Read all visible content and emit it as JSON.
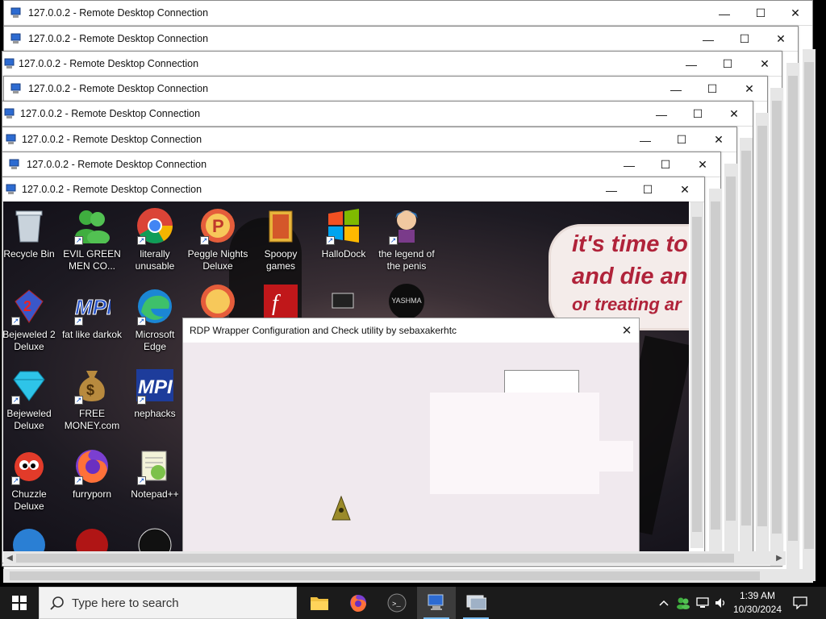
{
  "windows": [
    {
      "title": "127.0.0.2 - Remote Desktop Connection"
    },
    {
      "title": "127.0.0.2 - Remote Desktop Connection"
    },
    {
      "title": "127.0.0.2 - Remote Desktop Connection"
    },
    {
      "title": "127.0.0.2 - Remote Desktop Connection"
    },
    {
      "title": "127.0.0.2 - Remote Desktop Connection"
    },
    {
      "title": "127.0.0.2 - Remote Desktop Connection"
    },
    {
      "title": "127.0.0.2 - Remote Desktop Connection"
    },
    {
      "title": "127.0.0.2 - Remote Desktop Connection"
    }
  ],
  "caption_buttons": {
    "minimize": "—",
    "maximize": "☐",
    "close": "✕"
  },
  "desktop_icons": [
    {
      "label": "Recycle Bin",
      "icon": "recycle-bin-icon"
    },
    {
      "label": "EVIL GREEN MEN CO...",
      "icon": "green-people-icon"
    },
    {
      "label": "literally unusable",
      "icon": "chrome-icon"
    },
    {
      "label": "Peggle Nights Deluxe",
      "icon": "peggle-icon"
    },
    {
      "label": "Spoopy games",
      "icon": "folder-icon"
    },
    {
      "label": "HalloDock",
      "icon": "windows-logo-icon"
    },
    {
      "label": "the legend of the penis",
      "icon": "anime-character-icon"
    },
    {
      "label": "Bejeweled 2 Deluxe",
      "icon": "bejeweled2-icon"
    },
    {
      "label": "fat like darkok",
      "icon": "mpi-icon"
    },
    {
      "label": "Microsoft Edge",
      "icon": "edge-icon"
    },
    {
      "label": "Bejeweled Deluxe",
      "icon": "diamond-icon"
    },
    {
      "label": "FREE MONEY.com",
      "icon": "money-bag-icon"
    },
    {
      "label": "nephacks",
      "icon": "mpi-icon"
    },
    {
      "label": "Chuzzle Deluxe",
      "icon": "chuzzle-icon"
    },
    {
      "label": "furryporn",
      "icon": "firefox-icon"
    },
    {
      "label": "Notepad++",
      "icon": "notepadpp-icon"
    }
  ],
  "partial_icon_labels": [
    "YASHMA"
  ],
  "wallpaper_text": {
    "line1": "it's time to",
    "line2": "and die an",
    "line3": "or treating ar"
  },
  "dialog": {
    "title": "RDP Wrapper Configuration and Check utility by sebaxakerhtc",
    "close": "✕",
    "input_value": ""
  },
  "taskbar": {
    "search_placeholder": "Type here to search",
    "apps": [
      "file-explorer-icon",
      "firefox-icon",
      "terminal-icon",
      "remote-desktop-icon",
      "rdp-config-icon"
    ],
    "time": "1:39 AM",
    "date": "10/30/2024"
  },
  "colors": {
    "accent": "#76b9ed",
    "taskbar": "#1b1b1b",
    "dialog_bg": "#f0e9ee",
    "wallpaper_text": "#b0233a"
  }
}
